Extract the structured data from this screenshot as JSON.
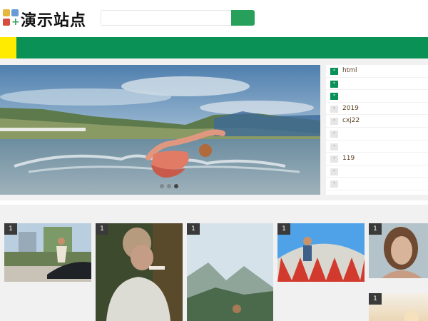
{
  "header": {
    "site_title": "演示站点",
    "search_placeholder": "",
    "search_value": ""
  },
  "nav": {
    "active_color": "#ffeb00",
    "bar_color": "#0a9156"
  },
  "banner": {
    "slide_count": 3,
    "active_slide": 3
  },
  "side_list": [
    {
      "label": "html",
      "badge": "*",
      "highlight": true
    },
    {
      "label": "",
      "badge": "*",
      "highlight": true
    },
    {
      "label": "",
      "badge": "*",
      "highlight": true
    },
    {
      "label": "2019",
      "badge": "*",
      "highlight": false
    },
    {
      "label": "cxj22",
      "badge": "*",
      "highlight": false
    },
    {
      "label": "",
      "badge": "*",
      "highlight": false
    },
    {
      "label": "",
      "badge": "*",
      "highlight": false
    },
    {
      "label": "119",
      "badge": "*",
      "highlight": false
    },
    {
      "label": "",
      "badge": "*",
      "highlight": false
    },
    {
      "label": "",
      "badge": "*",
      "highlight": false
    }
  ],
  "gallery": [
    {
      "count": "1",
      "subject": "woman-sitting-by-car"
    },
    {
      "count": "1",
      "subject": "woman-smoking-portrait"
    },
    {
      "count": "1",
      "subject": "person-in-mountain-valley"
    },
    {
      "count": "1",
      "subject": "circus-tent-performer"
    },
    {
      "count": "1",
      "subject": "woman-face-portrait"
    },
    {
      "count": "1",
      "subject": "sunset-sky"
    }
  ],
  "colors": {
    "accent_green": "#0a9156",
    "search_button": "#27a05b",
    "accent_yellow": "#ffeb00"
  }
}
